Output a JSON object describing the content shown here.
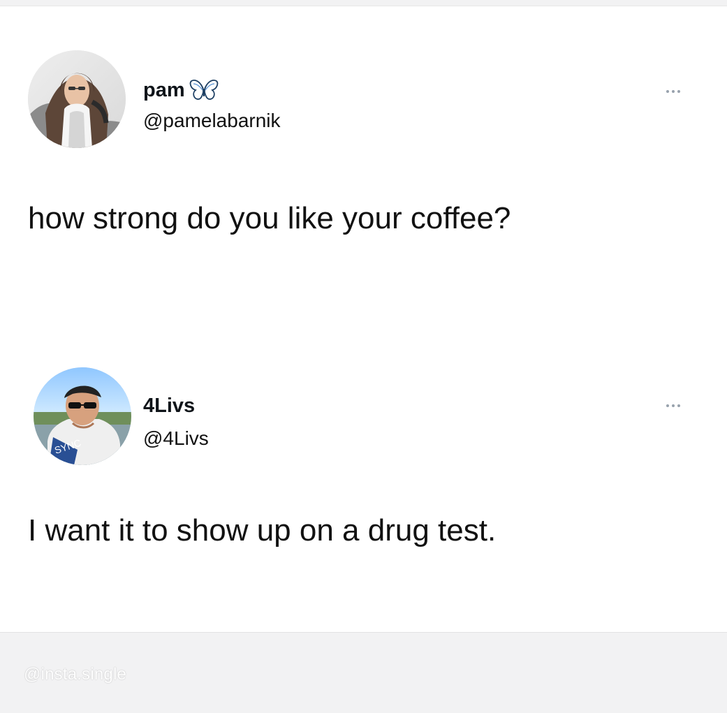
{
  "tweet1": {
    "avatar_icon": "profile-photo-icon",
    "display_name": "pam",
    "badge_icon": "butterfly-icon",
    "handle": "@pamelabarnik",
    "more_icon": "more-options-icon",
    "text": "how strong do you like your coffee?"
  },
  "tweet2": {
    "avatar_icon": "profile-photo-icon",
    "display_name": "4Livs",
    "handle": "@4Livs",
    "more_icon": "more-options-icon",
    "text": "I want it to show up on a drug test."
  },
  "watermark": {
    "text": "@insta.single"
  },
  "colors": {
    "text": "#111111",
    "muted": "#98a2ad",
    "background": "#ffffff",
    "page": "#f2f2f3",
    "accent": "#5f97d5"
  }
}
